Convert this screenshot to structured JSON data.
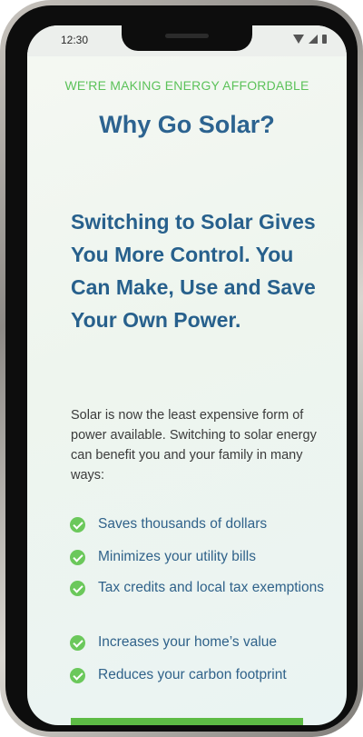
{
  "status_bar": {
    "time": "12:30",
    "icons": [
      "wifi-icon",
      "signal-icon",
      "battery-icon"
    ]
  },
  "page": {
    "eyebrow": "WE'RE MAKING ENERGY AFFORDABLE",
    "title": "Why Go Solar?",
    "headline": "Switching to Solar Gives You More Control. You Can Make, Use and Save Your Own Power.",
    "intro": "Solar is now the least expensive form of power available. Switching to solar energy can benefit you and your family in many ways:",
    "benefits": [
      "Saves thousands of dollars",
      "Minimizes your utility bills",
      "Tax credits and local tax exemptions",
      "Increases your home’s value",
      "Reduces your carbon footprint"
    ]
  },
  "colors": {
    "accent_green": "#5cc25a",
    "heading_blue": "#2c6390",
    "body_text": "#3b3b3b",
    "background": "#eef5ee"
  }
}
